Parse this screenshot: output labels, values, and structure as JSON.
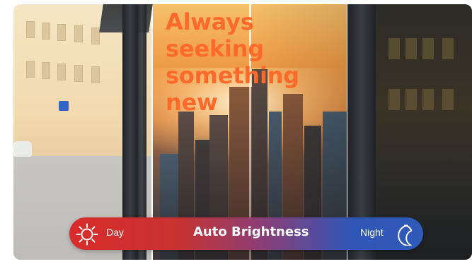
{
  "poster": {
    "headline": "Always seeking something new"
  },
  "brightness_bar": {
    "day_label": "Day",
    "title": "Auto Brightness",
    "night_label": "Night",
    "icons": {
      "left": "sun-icon",
      "right": "moon-icon"
    }
  },
  "colors": {
    "headline": "#ff6a2b",
    "bar_day": "#d82b2b",
    "bar_night": "#2f5ab8",
    "text": "#ffffff"
  }
}
